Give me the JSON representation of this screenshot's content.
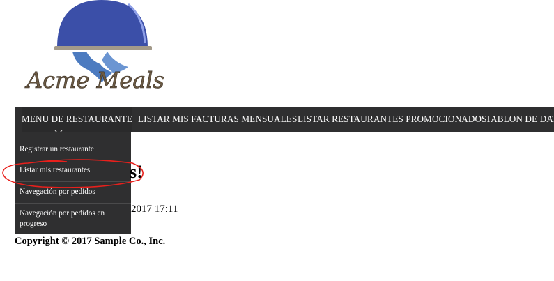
{
  "logo": {
    "text": "Acme Meals",
    "icon": "serving-cloche-icon"
  },
  "nav": {
    "items": [
      {
        "label": "MENU DE RESTAURANTE",
        "icon": "chevron-down-icon"
      },
      {
        "label": "LISTAR MIS FACTURAS MENSUALES"
      },
      {
        "label": "LISTAR RESTAURANTES PROMOCIONADOS"
      },
      {
        "label": "TABLON DE DAT"
      }
    ]
  },
  "dropdown": {
    "items": [
      {
        "label": "Registrar un restaurante"
      },
      {
        "label": "Listar mis restaurantes",
        "highlighted": true
      },
      {
        "label": "Navegación por pedidos"
      },
      {
        "label": "Navegación por pedidos en progreso"
      }
    ]
  },
  "main": {
    "welcome_tail": "s!",
    "date_tail": "2017 17:11"
  },
  "footer": {
    "copyright": "Copyright © 2017 Sample Co., Inc."
  },
  "colors": {
    "nav_bg": "#2f2f30",
    "nav_text": "#ffffff",
    "logo_dome": "#3b4fa8",
    "logo_text": "#6b5a43",
    "annotation": "#e8201c"
  }
}
